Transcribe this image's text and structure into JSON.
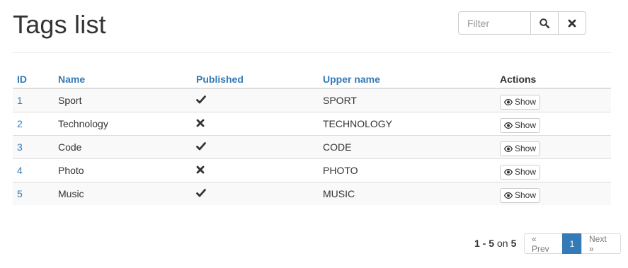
{
  "header": {
    "title": "Tags list",
    "filter_placeholder": "Filter"
  },
  "table": {
    "columns": {
      "id": "ID",
      "name": "Name",
      "published": "Published",
      "upper_name": "Upper name",
      "actions": "Actions"
    },
    "rows": [
      {
        "id": "1",
        "name": "Sport",
        "published": true,
        "upper_name": "SPORT",
        "action": "Show"
      },
      {
        "id": "2",
        "name": "Technology",
        "published": false,
        "upper_name": "TECHNOLOGY",
        "action": "Show"
      },
      {
        "id": "3",
        "name": "Code",
        "published": true,
        "upper_name": "CODE",
        "action": "Show"
      },
      {
        "id": "4",
        "name": "Photo",
        "published": false,
        "upper_name": "PHOTO",
        "action": "Show"
      },
      {
        "id": "5",
        "name": "Music",
        "published": true,
        "upper_name": "MUSIC",
        "action": "Show"
      }
    ]
  },
  "pagination": {
    "range": "1 - 5",
    "on_word": "on",
    "total": "5",
    "prev_label": "« Prev",
    "current_page": "1",
    "next_label": "Next »"
  },
  "icons": {
    "search": "search-icon",
    "clear": "close-icon",
    "published_true": "check-icon",
    "published_false": "cross-icon",
    "show": "eye-icon"
  },
  "colors": {
    "link": "#337ab7",
    "active_page": "#337ab7",
    "row_stripe": "#f9f9f9"
  }
}
